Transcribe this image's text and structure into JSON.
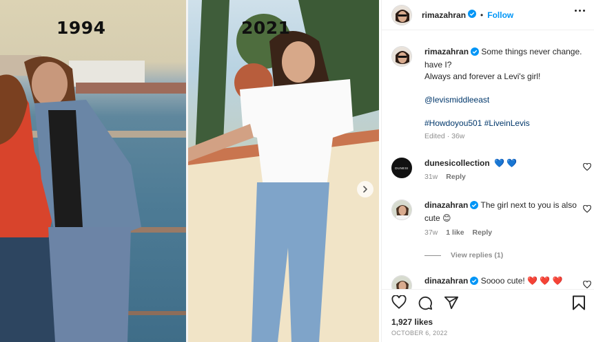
{
  "post": {
    "left_year": "1994",
    "right_year": "2021"
  },
  "header": {
    "username": "rimazahran",
    "separator": "•",
    "follow_label": "Follow"
  },
  "caption": {
    "username": "rimazahran",
    "line1": "Some things never change. have I?",
    "line2": "Always and forever a Levi's girl!",
    "mention": "@levismiddleeast",
    "hashtags": "#Howdoyou501 #LiveinLevis",
    "meta": "Edited · 36w"
  },
  "comments": [
    {
      "username": "dunesicollection",
      "text": "💙 💙",
      "age": "31w",
      "likes": "",
      "reply": "Reply",
      "avatar_text": "DUNESI"
    },
    {
      "username": "dinazahran",
      "text": "The girl next to you is also cute 😊",
      "age": "37w",
      "likes": "1 like",
      "reply": "Reply",
      "view_replies": "View replies (1)"
    },
    {
      "username": "dinazahran",
      "text": "Soooo cute! ❤️ ❤️ ❤️",
      "age": "",
      "likes": "",
      "reply": ""
    }
  ],
  "footer": {
    "likes": "1,927 likes",
    "date": "OCTOBER 6, 2022"
  },
  "icons": {
    "like": "heart-icon",
    "comment": "comment-icon",
    "share": "share-icon",
    "save": "bookmark-icon",
    "more": "more-options-icon",
    "verified": "verified-badge-icon",
    "next": "chevron-right-icon"
  },
  "colors": {
    "accent": "#0095f6",
    "verified": "#0095f6",
    "link": "#00376b",
    "muted": "#8e8e8e"
  }
}
